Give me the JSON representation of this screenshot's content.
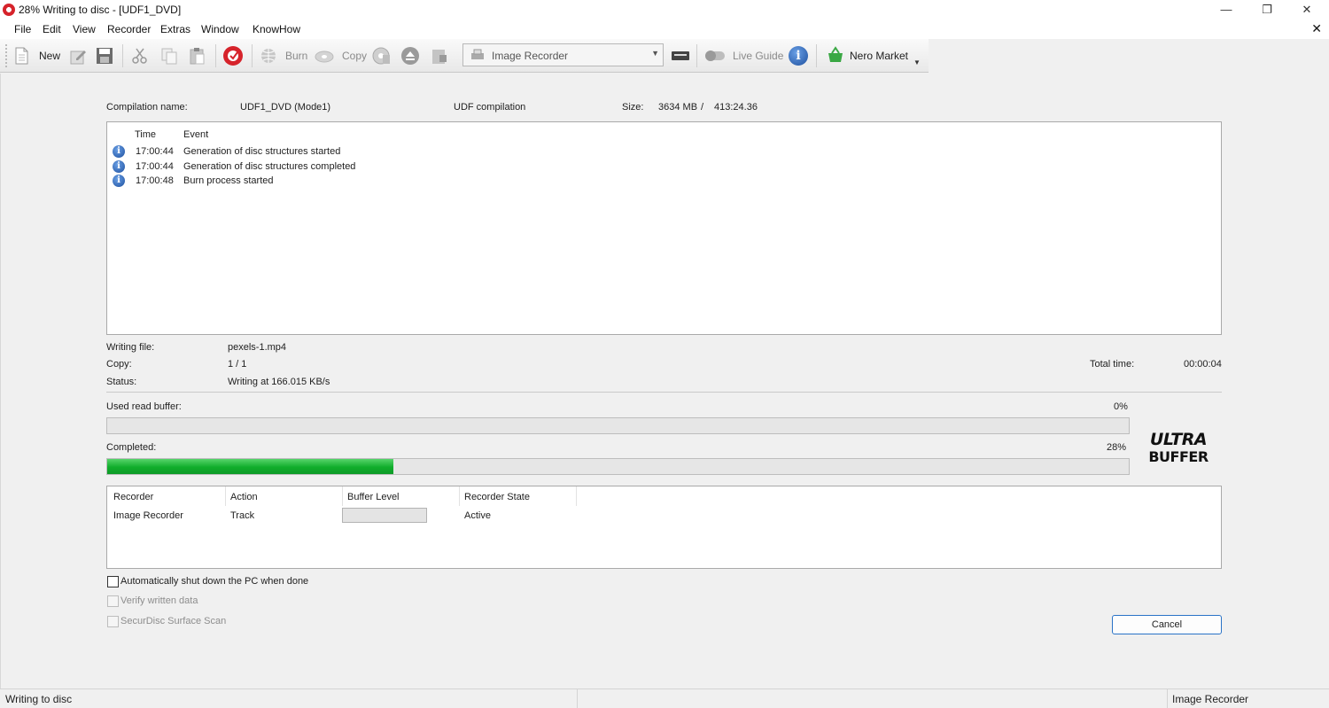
{
  "window": {
    "title": "28% Writing to disc - [UDF1_DVD]",
    "controls": {
      "minimize": "—",
      "restore": "❐",
      "close": "✕"
    }
  },
  "menu": {
    "items": [
      "File",
      "Edit",
      "View",
      "Recorder",
      "Extras",
      "Window",
      "KnowHow"
    ],
    "close_glyph": "✕"
  },
  "toolbar": {
    "new_label": "New",
    "burn_label": "Burn",
    "copy_label": "Copy",
    "recorder_selected": "Image Recorder",
    "live_guide_label": "Live Guide",
    "market_label": "Nero Market",
    "icons": [
      "new-icon",
      "edit-icon",
      "save-icon",
      "cut-icon",
      "copy-icon",
      "paste-icon",
      "nero-icon",
      "burn-globe-icon",
      "burn-disc-icon",
      "copy-disc-icon",
      "eject-icon",
      "lock-icon",
      "drive-icon",
      "toggle-icon",
      "info-icon",
      "market-basket-icon"
    ]
  },
  "compilation": {
    "name_label": "Compilation name:",
    "name_value": "UDF1_DVD (Mode1)",
    "type": "UDF compilation",
    "size_label": "Size:",
    "size_mb": "3634 MB",
    "size_sep": "/",
    "size_time": "413:24.36"
  },
  "log": {
    "col_time": "Time",
    "col_event": "Event",
    "rows": [
      {
        "time": "17:00:44",
        "event": "Generation of disc structures started"
      },
      {
        "time": "17:00:44",
        "event": "Generation of disc structures completed"
      },
      {
        "time": "17:00:48",
        "event": "Burn process started"
      }
    ]
  },
  "status_info": {
    "writing_file_label": "Writing file:",
    "writing_file_value": "pexels-1.mp4",
    "copy_label": "Copy:",
    "copy_value": "1 / 1",
    "status_label": "Status:",
    "status_value": "Writing at 166.015 KB/s",
    "total_time_label": "Total time:",
    "total_time_value": "00:00:04"
  },
  "buffer": {
    "label": "Used read buffer:",
    "percent_text": "0%",
    "fraction": 0.0
  },
  "completed": {
    "label": "Completed:",
    "percent_text": "28%",
    "fraction": 0.28
  },
  "logo": {
    "line1": "ULTRA",
    "line2": "BUFFER"
  },
  "recorder_table": {
    "headers": [
      "Recorder",
      "Action",
      "Buffer Level",
      "Recorder State"
    ],
    "row": {
      "recorder": "Image Recorder",
      "action": "Track",
      "state": "Active"
    }
  },
  "options": {
    "shutdown": "Automatically shut down the PC when done",
    "verify": "Verify written data",
    "securdisc": "SecurDisc Surface Scan"
  },
  "cancel_label": "Cancel",
  "statusbar": {
    "left": "Writing to disc",
    "right": "Image Recorder"
  },
  "colors": {
    "progress_green": "#10ad2b",
    "accent_blue": "#2a73c7",
    "nero_red": "#d6232b"
  }
}
